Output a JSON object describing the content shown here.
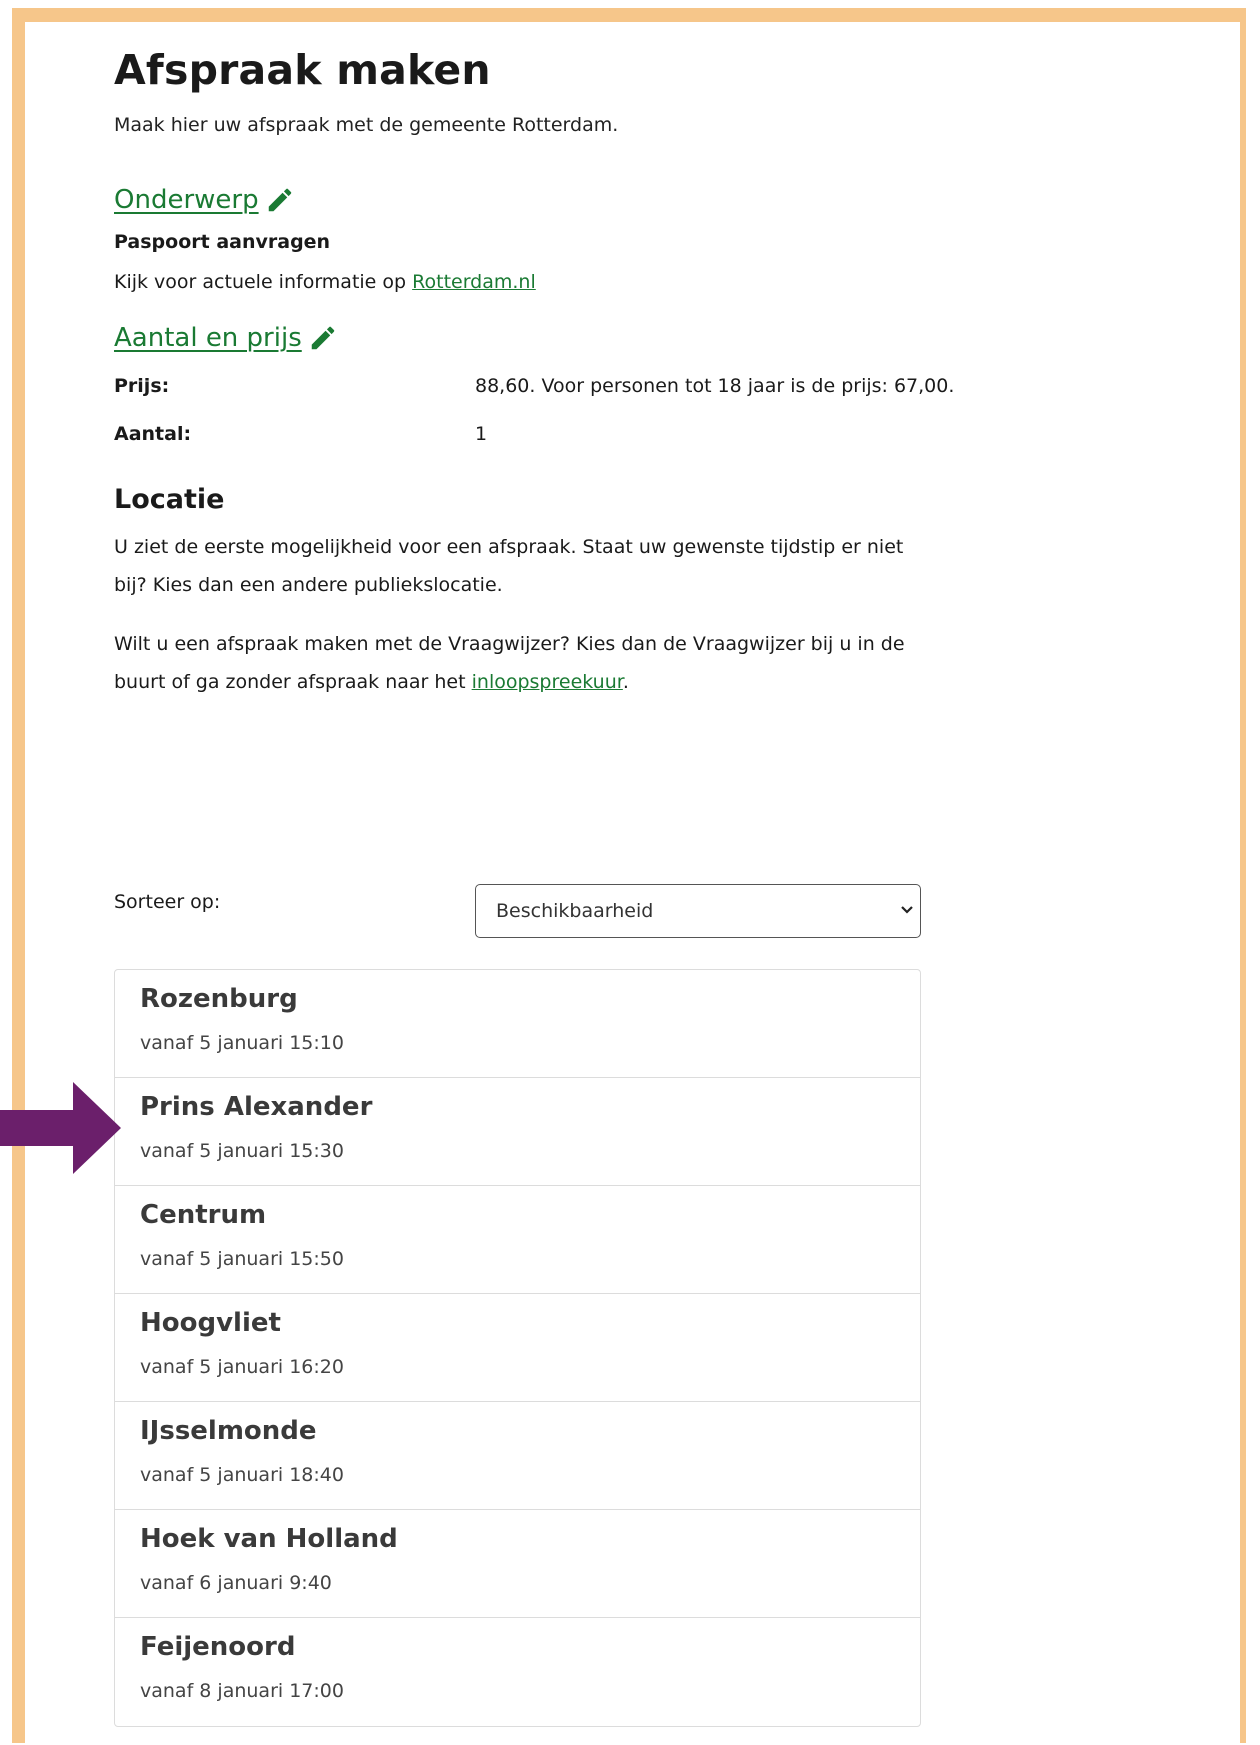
{
  "header": {
    "title": "Afspraak maken",
    "intro": "Maak hier uw afspraak met de gemeente Rotterdam."
  },
  "subject": {
    "heading": "Onderwerp",
    "value": "Paspoort aanvragen",
    "info_prefix": "Kijk voor actuele informatie op ",
    "info_link": "Rotterdam.nl"
  },
  "amount": {
    "heading": "Aantal en prijs",
    "price_label": "Prijs:",
    "price_value": "88,60. Voor personen tot 18 jaar is de prijs: 67,00.",
    "count_label": "Aantal:",
    "count_value": "1"
  },
  "location": {
    "heading": "Locatie",
    "para1": "U ziet de eerste mogelijkheid voor een afspraak. Staat uw gewenste tijdstip er niet bij? Kies dan een andere publiekslocatie.",
    "para2_prefix": "Wilt u een afspraak maken met de Vraagwijzer? Kies dan de Vraagwijzer bij u in de buurt of ga zonder afspraak naar het ",
    "para2_link": "inloopspreekuur",
    "para2_suffix": "."
  },
  "sort": {
    "label": "Sorteer op:",
    "selected": "Beschikbaarheid"
  },
  "locations": [
    {
      "name": "Rozenburg",
      "time": "vanaf 5 januari 15:10"
    },
    {
      "name": "Prins Alexander",
      "time": "vanaf 5 januari 15:30"
    },
    {
      "name": "Centrum",
      "time": "vanaf 5 januari 15:50"
    },
    {
      "name": "Hoogvliet",
      "time": "vanaf 5 januari 16:20"
    },
    {
      "name": "IJsselmonde",
      "time": "vanaf 5 januari 18:40"
    },
    {
      "name": "Hoek van Holland",
      "time": "vanaf 6 januari 9:40"
    },
    {
      "name": "Feijenoord",
      "time": "vanaf 8 januari 17:00"
    }
  ],
  "colors": {
    "frame": "#f6c68a",
    "link_green": "#1a7a33",
    "arrow_purple": "#6b1f6b"
  },
  "icons": {
    "edit": "pencil-icon",
    "select": "chevron-down-icon",
    "pointer": "arrow-right-icon"
  }
}
